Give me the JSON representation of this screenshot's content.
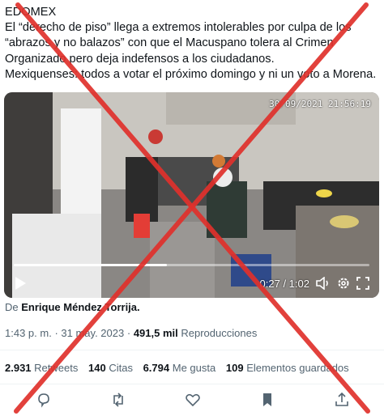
{
  "tweet": {
    "lines": [
      "EDOMEX",
      "El “derecho de piso” llega a extremos intolerables por culpa de los",
      "“abrazos y no balazos” con que el Macuspano tolera al Crimen",
      "Organizado pero deja indefensos a los ciudadanos.",
      "Mexiquenses: todos a votar el próximo domingo y ni un voto a Morena."
    ]
  },
  "video": {
    "timestamp": "30/09/2021 21:56:19",
    "time": "0:27 / 1:02",
    "progress_fraction": 0.43
  },
  "author": {
    "prefix": "De",
    "name": "Enrique Méndez Torrija."
  },
  "meta": {
    "time": "1:43 p. m.",
    "sep1": "·",
    "date": "31 may. 2023",
    "sep2": "·",
    "views": "491,5 mil",
    "views_label": "Reproducciones"
  },
  "stats": {
    "retweets": "2.931",
    "retweets_label": "Retweets",
    "quotes": "140",
    "quotes_label": "Citas",
    "likes": "6.794",
    "likes_label": "Me gusta",
    "bookmarks": "109",
    "bookmarks_label": "Elementos guardados"
  },
  "icons": {
    "play": "play-icon",
    "mute": "volume-icon",
    "settings": "gear-icon",
    "fullscreen": "fullscreen-icon",
    "reply": "reply-icon",
    "retweet": "retweet-icon",
    "like": "heart-icon",
    "bookmark": "bookmark-icon",
    "share": "share-icon"
  },
  "colors": {
    "overlay_x": "#e0312c",
    "text": "#0f1419",
    "muted": "#536471"
  }
}
